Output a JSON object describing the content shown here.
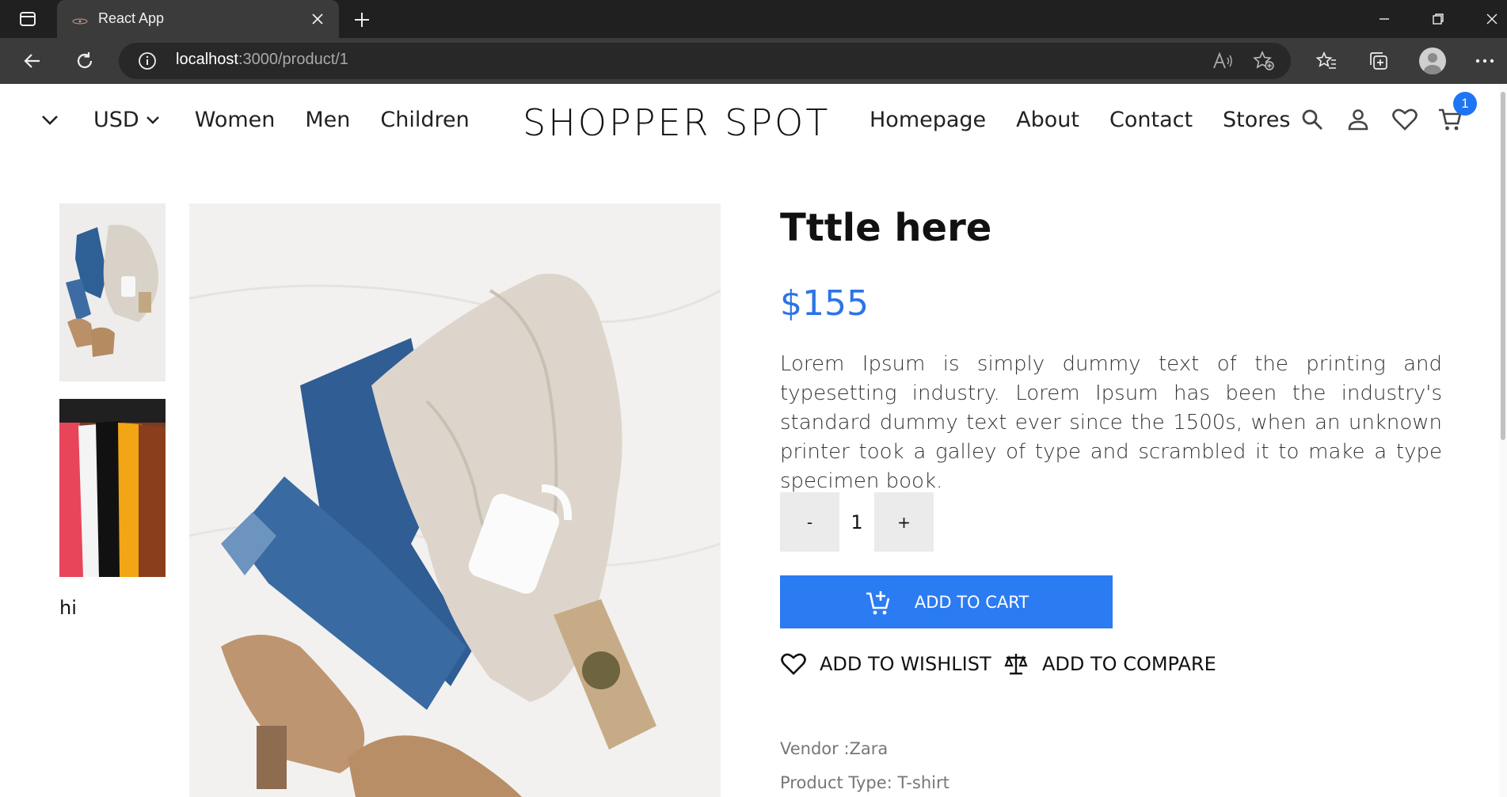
{
  "browser": {
    "tab_title": "React App",
    "url_host": "localhost",
    "url_path": ":3000/product/1"
  },
  "header": {
    "currency": "USD",
    "left_links": [
      "Women",
      "Men",
      "Children"
    ],
    "brand": "SHOPPER SPOT",
    "right_links": [
      "Homepage",
      "About",
      "Contact",
      "Stores"
    ],
    "cart_count": "1"
  },
  "gallery": {
    "caption": "hi"
  },
  "product": {
    "title": "Tttle here",
    "price": "$155",
    "description": "Lorem Ipsum is simply dummy text of the printing and typesetting industry. Lorem Ipsum has been the industry's standard dummy text ever since the 1500s, when an unknown printer took a galley of type and scrambled it to make a type specimen book.",
    "quantity": "1",
    "minus_label": "-",
    "plus_label": "+",
    "add_to_cart": "ADD TO CART",
    "add_to_wishlist": "ADD TO WISHLIST",
    "add_to_compare": "ADD TO COMPARE",
    "vendor": "Vendor :Zara",
    "product_type": "Product Type: T-shirt"
  },
  "colors": {
    "accent": "#2b7bf3",
    "price": "#2d74e6",
    "badge": "#1f74f3"
  }
}
